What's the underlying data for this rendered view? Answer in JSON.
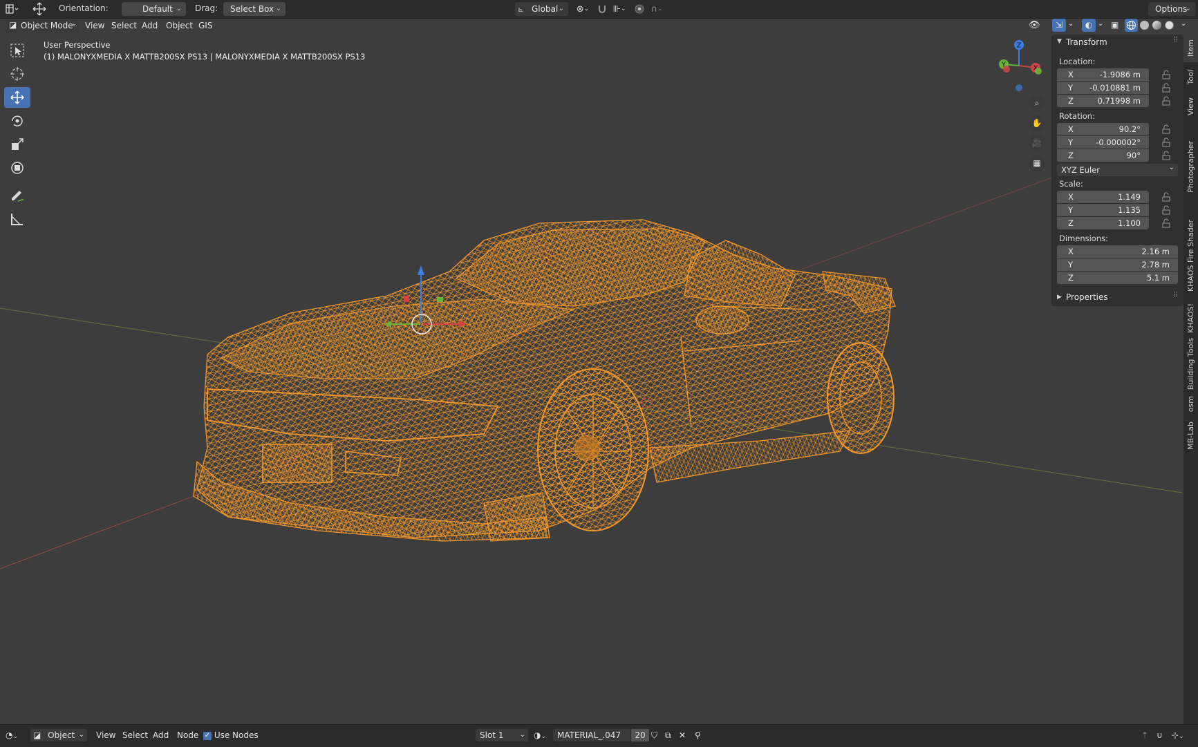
{
  "top_header": {
    "orientation_label": "Orientation:",
    "orientation_value": "Default",
    "drag_label": "Drag:",
    "drag_value": "Select Box",
    "transform_space": "Global",
    "options_label": "Options"
  },
  "viewport_header": {
    "mode": "Object Mode",
    "menus": [
      "View",
      "Select",
      "Add",
      "Object",
      "GIS"
    ]
  },
  "viewport": {
    "view_name": "User Perspective",
    "object_info": "(1) MALONYXMEDIA X MATTB200SX PS13 | MALONYXMEDIA X MATTB200SX PS13",
    "wire_color": "#f0962a",
    "gizmo_axes": {
      "x": "X",
      "y": "Y",
      "z": "Z"
    }
  },
  "toolbar": {
    "tools": [
      "select-box",
      "cursor",
      "move",
      "rotate",
      "scale",
      "transform",
      "annotate",
      "measure"
    ],
    "active_tool": "move"
  },
  "nav_gizmo_icons": [
    "zoom-icon",
    "pan-hand-icon",
    "camera-icon",
    "grid-view-icon"
  ],
  "npanel": {
    "transform_title": "Transform",
    "location_label": "Location:",
    "location": [
      {
        "axis": "X",
        "value": "-1.9086 m"
      },
      {
        "axis": "Y",
        "value": "-0.010881 m"
      },
      {
        "axis": "Z",
        "value": "0.71998 m"
      }
    ],
    "rotation_label": "Rotation:",
    "rotation": [
      {
        "axis": "X",
        "value": "90.2°"
      },
      {
        "axis": "Y",
        "value": "-0.000002°"
      },
      {
        "axis": "Z",
        "value": "90°"
      }
    ],
    "rotation_mode": "XYZ Euler",
    "scale_label": "Scale:",
    "scale": [
      {
        "axis": "X",
        "value": "1.149"
      },
      {
        "axis": "Y",
        "value": "1.135"
      },
      {
        "axis": "Z",
        "value": "1.100"
      }
    ],
    "dimensions_label": "Dimensions:",
    "dimensions": [
      {
        "axis": "X",
        "value": "2.16 m"
      },
      {
        "axis": "Y",
        "value": "2.78 m"
      },
      {
        "axis": "Z",
        "value": "5.1 m"
      }
    ],
    "properties_title": "Properties"
  },
  "side_tabs": [
    "Item",
    "Tool",
    "View",
    "Photographer",
    "KHAOS Fire Shader",
    "KHAOS!",
    "Building Tools",
    "osm",
    "MB-Lab"
  ],
  "bottom_header": {
    "editor_mode": "Object",
    "menus": [
      "View",
      "Select",
      "Add",
      "Node"
    ],
    "use_nodes_label": "Use Nodes",
    "use_nodes_checked": true,
    "slot": "Slot 1",
    "material_name": "MATERIAL_.047",
    "user_count": "20"
  }
}
